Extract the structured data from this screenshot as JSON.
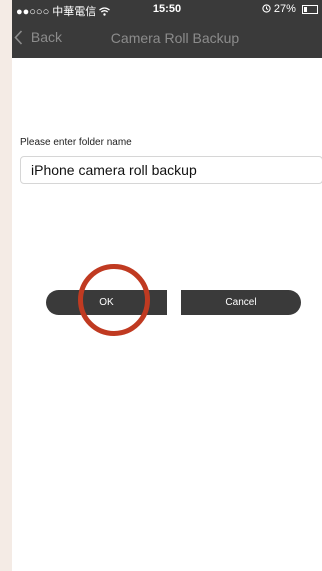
{
  "status_bar": {
    "carrier": "●●○○○ 中華電信",
    "wifi_icon": "wifi-icon",
    "time": "15:50",
    "battery_percent": "27%",
    "battery_level": 0.27,
    "alarm_icon": "alarm-icon"
  },
  "nav": {
    "back_label": "Back",
    "back_icon": "chevron-left-icon",
    "title": "Camera Roll Backup"
  },
  "form": {
    "label": "Please enter folder name",
    "folder_name_value": "iPhone camera roll backup"
  },
  "buttons": {
    "ok_label": "OK",
    "cancel_label": "Cancel"
  },
  "colors": {
    "bar": "#3a3a3a",
    "highlight": "#c03a21",
    "frame": "#f4ebe5"
  }
}
